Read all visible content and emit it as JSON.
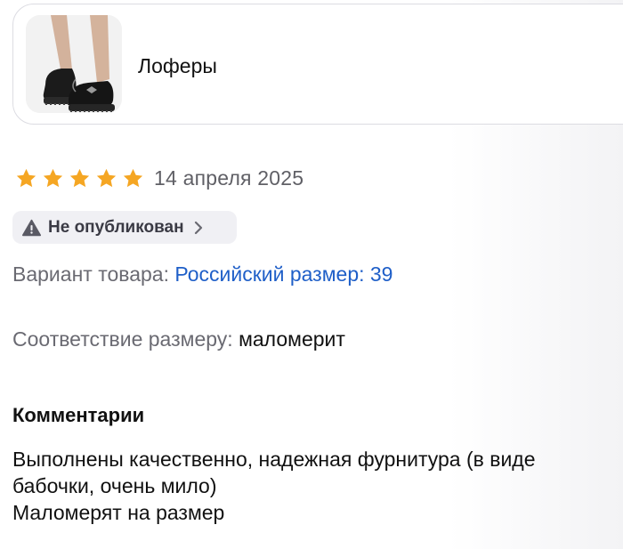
{
  "product": {
    "title": "Лоферы",
    "image_icon": "loafers-photo"
  },
  "review": {
    "rating": 5,
    "rating_max": 5,
    "star_color": "#f5a623",
    "date": "14 апреля 2025"
  },
  "status": {
    "icon": "warning-triangle-icon",
    "label": "Не опубликован",
    "chevron": "chevron-right-icon"
  },
  "variant": {
    "label": "Вариант товара:",
    "value": "Российский размер: 39",
    "value_color": "#1f5fc8"
  },
  "size_fit": {
    "label": "Соответствие размеру:",
    "value": "маломерит"
  },
  "comments": {
    "title": "Комментарии",
    "lines": [
      "Выполнены качественно, надежная фурнитура (в виде",
      "бабочки, очень мило)",
      "Маломерят на размер"
    ]
  }
}
